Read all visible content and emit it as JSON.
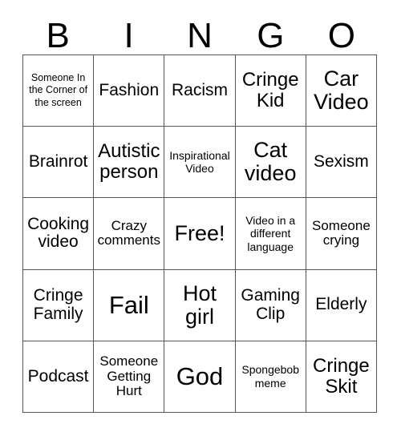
{
  "card": {
    "type": "bingo-card",
    "columns": 5,
    "rows": 5,
    "header_letters": [
      "B",
      "I",
      "N",
      "G",
      "O"
    ],
    "free_space_label": "Free!",
    "free_space_position": {
      "row": 3,
      "column": 3
    },
    "text_color": "#000000",
    "background_color": "#ffffff",
    "grid_line_color": "#555555"
  },
  "header": {
    "b": "B",
    "i": "I",
    "n": "N",
    "g": "G",
    "o": "O"
  },
  "grid": {
    "rows": [
      {
        "cells": [
          {
            "label": "Someone In the Corner of the screen",
            "size": "xxs"
          },
          {
            "label": "Fashion",
            "size": "md"
          },
          {
            "label": "Racism",
            "size": "md"
          },
          {
            "label": "Cringe Kid",
            "size": "lg"
          },
          {
            "label": "Car Video",
            "size": "xl"
          }
        ]
      },
      {
        "cells": [
          {
            "label": "Brainrot",
            "size": "md"
          },
          {
            "label": "Autistic person",
            "size": "lg"
          },
          {
            "label": "Inspirational Video",
            "size": "xs"
          },
          {
            "label": "Cat video",
            "size": "xl"
          },
          {
            "label": "Sexism",
            "size": "md"
          }
        ]
      },
      {
        "cells": [
          {
            "label": "Cooking video",
            "size": "md"
          },
          {
            "label": "Crazy comments",
            "size": "sm"
          },
          {
            "label": "Free!",
            "size": "xl"
          },
          {
            "label": "Video in a different language",
            "size": "xs"
          },
          {
            "label": "Someone crying",
            "size": "sm"
          }
        ]
      },
      {
        "cells": [
          {
            "label": "Cringe Family",
            "size": "md"
          },
          {
            "label": "Fail",
            "size": "xxl"
          },
          {
            "label": "Hot girl",
            "size": "xl"
          },
          {
            "label": "Gaming Clip",
            "size": "md"
          },
          {
            "label": "Elderly",
            "size": "md"
          }
        ]
      },
      {
        "cells": [
          {
            "label": "Podcast",
            "size": "md"
          },
          {
            "label": "Someone Getting Hurt",
            "size": "sm"
          },
          {
            "label": "God",
            "size": "xxl"
          },
          {
            "label": "Spongebob meme",
            "size": "xs"
          },
          {
            "label": "Cringe Skit",
            "size": "lg"
          }
        ]
      }
    ]
  }
}
